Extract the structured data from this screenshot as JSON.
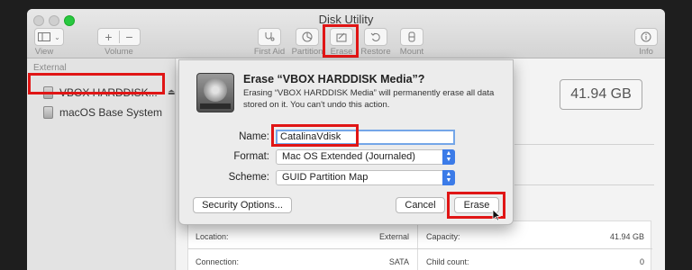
{
  "window": {
    "title": "Disk Utility"
  },
  "toolbar": {
    "view_label": "View",
    "volume_label": "Volume",
    "volume_add": "+",
    "volume_remove": "−",
    "first_aid_label": "First Aid",
    "partition_label": "Partition",
    "erase_label": "Erase",
    "restore_label": "Restore",
    "mount_label": "Mount",
    "info_label": "Info"
  },
  "sidebar": {
    "section": "External",
    "items": [
      {
        "label": "VBOX HARDDISK...",
        "selected": true,
        "has_eject": true
      },
      {
        "label": "macOS Base System",
        "selected": false,
        "has_eject": false
      }
    ]
  },
  "main": {
    "capacity": "41.94 GB",
    "info_rows": [
      {
        "left_label": "Location:",
        "left_value": "External",
        "right_label": "Capacity:",
        "right_value": "41.94 GB"
      },
      {
        "left_label": "Connection:",
        "left_value": "SATA",
        "right_label": "Child count:",
        "right_value": "0"
      }
    ]
  },
  "dialog": {
    "title": "Erase “VBOX HARDDISK Media”?",
    "message": "Erasing “VBOX HARDDISK Media” will permanently erase all data stored on it. You can't undo this action.",
    "name_label": "Name:",
    "name_value": "CatalinaVdisk",
    "format_label": "Format:",
    "format_value": "Mac OS Extended (Journaled)",
    "scheme_label": "Scheme:",
    "scheme_value": "GUID Partition Map",
    "security_button": "Security Options...",
    "cancel_button": "Cancel",
    "erase_button": "Erase"
  },
  "colors": {
    "highlight": "#e01515",
    "accent": "#3b7be8",
    "focus_ring": "#74a6e8",
    "maximize": "#28c840"
  }
}
